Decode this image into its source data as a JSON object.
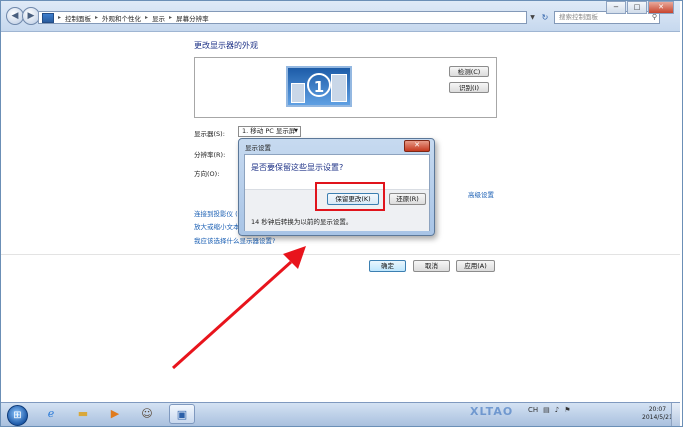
{
  "window": {
    "breadcrumb": [
      "控制面板",
      "外观和个性化",
      "显示",
      "屏幕分辨率"
    ],
    "search_placeholder": "搜索控制面板",
    "min_label": "−",
    "max_label": "□",
    "close_label": "✕"
  },
  "page": {
    "title": "更改显示器的外观",
    "detect_button": "检测(C)",
    "identify_button": "识别(I)",
    "monitor_number": "1",
    "display_label": "显示器(S):",
    "display_value": "1. 移动 PC 显示屏",
    "resolution_label": "分辨率(R):",
    "orientation_label": "方向(O):",
    "advanced_link": "高级设置",
    "links": [
      "连接到投影仪 (也",
      "放大或缩小文本",
      "我应该选择什么显示器设置?"
    ],
    "ok_button": "确定",
    "cancel_button": "取消",
    "apply_button": "应用(A)"
  },
  "dialog": {
    "title": "显示设置",
    "close_label": "✕",
    "question": "是否要保留这些显示设置?",
    "keep_button": "保留更改(K)",
    "revert_button": "还原(R)",
    "countdown_note": "14 秒钟后转换为以前的显示设置。"
  },
  "taskbar": {
    "tray_lang": "CH",
    "time": "20:07",
    "date": "2014/5/21",
    "watermark": "XLTAO"
  },
  "colors": {
    "highlight": "#e0141c",
    "arrow": "#e8141c",
    "link": "#1a5fb4"
  },
  "icons": [
    "control-panel-icon",
    "back-icon",
    "forward-icon",
    "refresh-icon",
    "search-icon",
    "monitor-icon",
    "start-orb-icon",
    "ie-icon",
    "folder-icon",
    "media-player-icon",
    "avatar-icon",
    "display-settings-icon"
  ]
}
